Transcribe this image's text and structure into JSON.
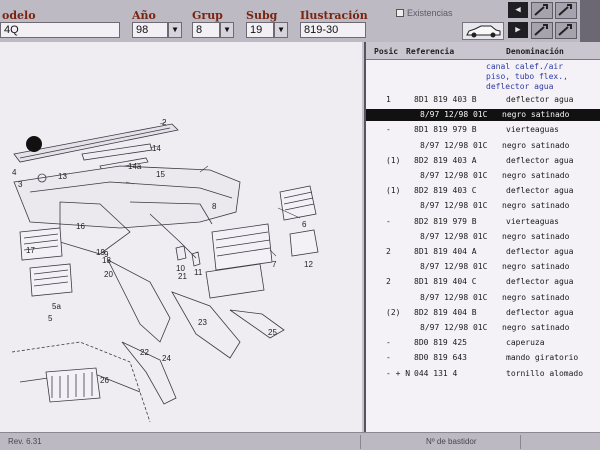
{
  "filters": {
    "modelo": {
      "label": "odelo",
      "value": "4Q"
    },
    "anio": {
      "label": "Año",
      "value": "98"
    },
    "grup": {
      "label": "Grup",
      "value": "8"
    },
    "subg": {
      "label": "Subg",
      "value": "19"
    },
    "ilustracion": {
      "label": "Ilustración",
      "value": "819-30"
    },
    "existencias_label": "Existencias"
  },
  "diagram": {
    "callouts": [
      "2",
      "3",
      "4",
      "5",
      "5a",
      "6",
      "7",
      "8",
      "9",
      "10",
      "11",
      "12",
      "13",
      "14",
      "14a",
      "15",
      "16",
      "17",
      "18",
      "19",
      "20",
      "21",
      "22",
      "23",
      "24",
      "25",
      "26"
    ]
  },
  "parts": {
    "headers": {
      "pos": "Posic",
      "ref": "Referencia",
      "den": "Denominación"
    },
    "group_description": [
      "canal calef./air",
      "piso, tubo flex.,",
      "deflector agua"
    ],
    "rows": [
      {
        "kind": "main",
        "pos": "1",
        "ref": "8D1 819 403 B",
        "den": "deflector agua"
      },
      {
        "kind": "sub",
        "ref": "8/97 12/98 01C",
        "den": "negro satinado",
        "selected": true
      },
      {
        "kind": "main",
        "pos": "-",
        "ref": "8D1 819 979 B",
        "den": "vierteaguas"
      },
      {
        "kind": "sub",
        "ref": "8/97 12/98 01C",
        "den": "negro satinado"
      },
      {
        "kind": "main",
        "pos": "(1)",
        "ref": "8D2 819 403 A",
        "den": "deflector agua"
      },
      {
        "kind": "sub",
        "ref": "8/97 12/98 01C",
        "den": "negro satinado"
      },
      {
        "kind": "main",
        "pos": "(1)",
        "ref": "8D2 819 403 C",
        "den": "deflector agua"
      },
      {
        "kind": "sub",
        "ref": "8/97 12/98 01C",
        "den": "negro satinado"
      },
      {
        "kind": "main",
        "pos": "-",
        "ref": "8D2 819 979 B",
        "den": "vierteaguas"
      },
      {
        "kind": "sub",
        "ref": "8/97 12/98 01C",
        "den": "negro satinado"
      },
      {
        "kind": "main",
        "pos": "2",
        "ref": "8D1 819 404 A",
        "den": "deflector agua"
      },
      {
        "kind": "sub",
        "ref": "8/97 12/98 01C",
        "den": "negro satinado"
      },
      {
        "kind": "main",
        "pos": "2",
        "ref": "8D1 819 404 C",
        "den": "deflector agua"
      },
      {
        "kind": "sub",
        "ref": "8/97 12/98 01C",
        "den": "negro satinado"
      },
      {
        "kind": "main",
        "pos": "(2)",
        "ref": "8D2 819 404 B",
        "den": "deflector agua"
      },
      {
        "kind": "sub",
        "ref": "8/97 12/98 01C",
        "den": "negro satinado"
      },
      {
        "kind": "main",
        "pos": "-",
        "ref": "8D0 819 425",
        "den": "caperuza"
      },
      {
        "kind": "main",
        "pos": "-",
        "ref": "8D0 819 643",
        "den": "mando giratorio"
      },
      {
        "kind": "main",
        "pos": "- + N",
        "ref": "044 131 4",
        "den": "tornillo alomado"
      }
    ]
  },
  "status": {
    "rev": "Rev. 6.31",
    "bastidor": "Nº de bastidor"
  },
  "icons": {
    "car": "car-icon",
    "nav_prev": "arrow-left-icon",
    "nav_next": "arrow-right-icon",
    "tools": [
      "wrench-icon",
      "wrench-icon",
      "wrench-icon",
      "wrench-icon"
    ]
  },
  "colors": {
    "label_red": "#7a2410",
    "desc_blue": "#2d3aa5",
    "selection": "#111111"
  }
}
